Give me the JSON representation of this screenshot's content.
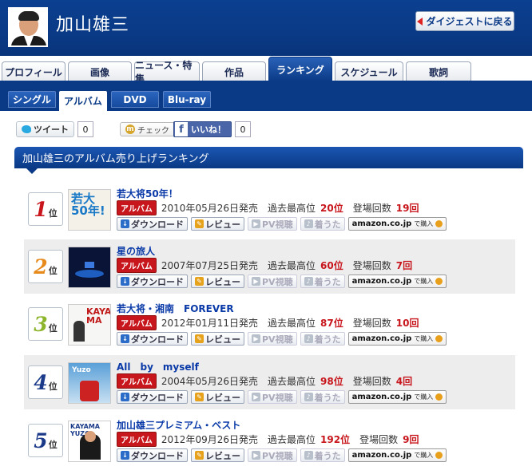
{
  "header": {
    "artist_name": "加山雄三",
    "back_label": "ダイジェストに戻る"
  },
  "tabs": [
    {
      "label": "プロフィール",
      "active": false
    },
    {
      "label": "画像",
      "active": false
    },
    {
      "label": "ニュース・特集",
      "active": false
    },
    {
      "label": "作品",
      "active": false
    },
    {
      "label": "ランキング",
      "active": true
    },
    {
      "label": "スケジュール",
      "active": false
    },
    {
      "label": "歌詞",
      "active": false
    }
  ],
  "subtabs": [
    {
      "label": "シングル",
      "active": false
    },
    {
      "label": "アルバム",
      "active": true
    },
    {
      "label": "DVD",
      "active": false
    },
    {
      "label": "Blu-ray",
      "active": false
    }
  ],
  "social": {
    "tweet_label": "ツイート",
    "tweet_count": "0",
    "check_label": "チェック",
    "like_label": "いいね！",
    "like_count": "0"
  },
  "section_title": "加山雄三のアルバム売り上げランキング",
  "labels": {
    "badge": "アルバム",
    "release_suffix": "発売",
    "peak_label": "過去最高位",
    "appear_label": "登場回数",
    "download": "ダウンロード",
    "review": "レビュー",
    "pv": "PV視聴",
    "chaku": "着うた",
    "amazon": "amazon.co.jp",
    "amazon_buy": "で購入",
    "rank_suffix": "位"
  },
  "rankings": [
    {
      "rank": "1",
      "title": "若大将50年！",
      "release": "2010年05月26日",
      "peak": "20位",
      "appearances": "19回"
    },
    {
      "rank": "2",
      "title": "星の旅人",
      "release": "2007年07月25日",
      "peak": "60位",
      "appearances": "7回"
    },
    {
      "rank": "3",
      "title": "若大将・湘南　FOREVER",
      "release": "2012年01月11日",
      "peak": "87位",
      "appearances": "10回"
    },
    {
      "rank": "4",
      "title": "All　by　myself",
      "release": "2004年05月26日",
      "peak": "98位",
      "appearances": "4回"
    },
    {
      "rank": "5",
      "title": "加山雄三プレミアム・ベスト",
      "release": "2012年09月26日",
      "peak": "192位",
      "appearances": "9回"
    }
  ],
  "colors": {
    "brand_blue": "#0a3a86",
    "accent_red": "#c8161d"
  }
}
